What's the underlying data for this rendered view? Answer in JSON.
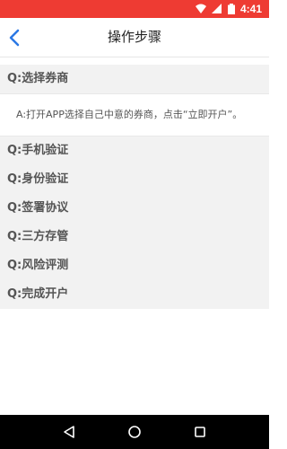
{
  "status_bar": {
    "time": "4:41"
  },
  "header": {
    "title": "操作步骤"
  },
  "faq": [
    {
      "question": "Q:选择券商",
      "answer": "A:打开APP选择自己中意的券商，点击“立即开户”。"
    },
    {
      "question": "Q:手机验证"
    },
    {
      "question": "Q:身份验证"
    },
    {
      "question": "Q:签署协议"
    },
    {
      "question": "Q:三方存管"
    },
    {
      "question": "Q:风险评测"
    },
    {
      "question": "Q:完成开户"
    }
  ],
  "colors": {
    "status_bar": "#ee3b33",
    "accent": "#2b78e4",
    "section_bg": "#f2f2f2"
  },
  "icons": [
    "wifi-icon",
    "signal-icon",
    "battery-icon",
    "back-arrow-icon",
    "nav-back-icon",
    "nav-home-icon",
    "nav-recents-icon"
  ]
}
